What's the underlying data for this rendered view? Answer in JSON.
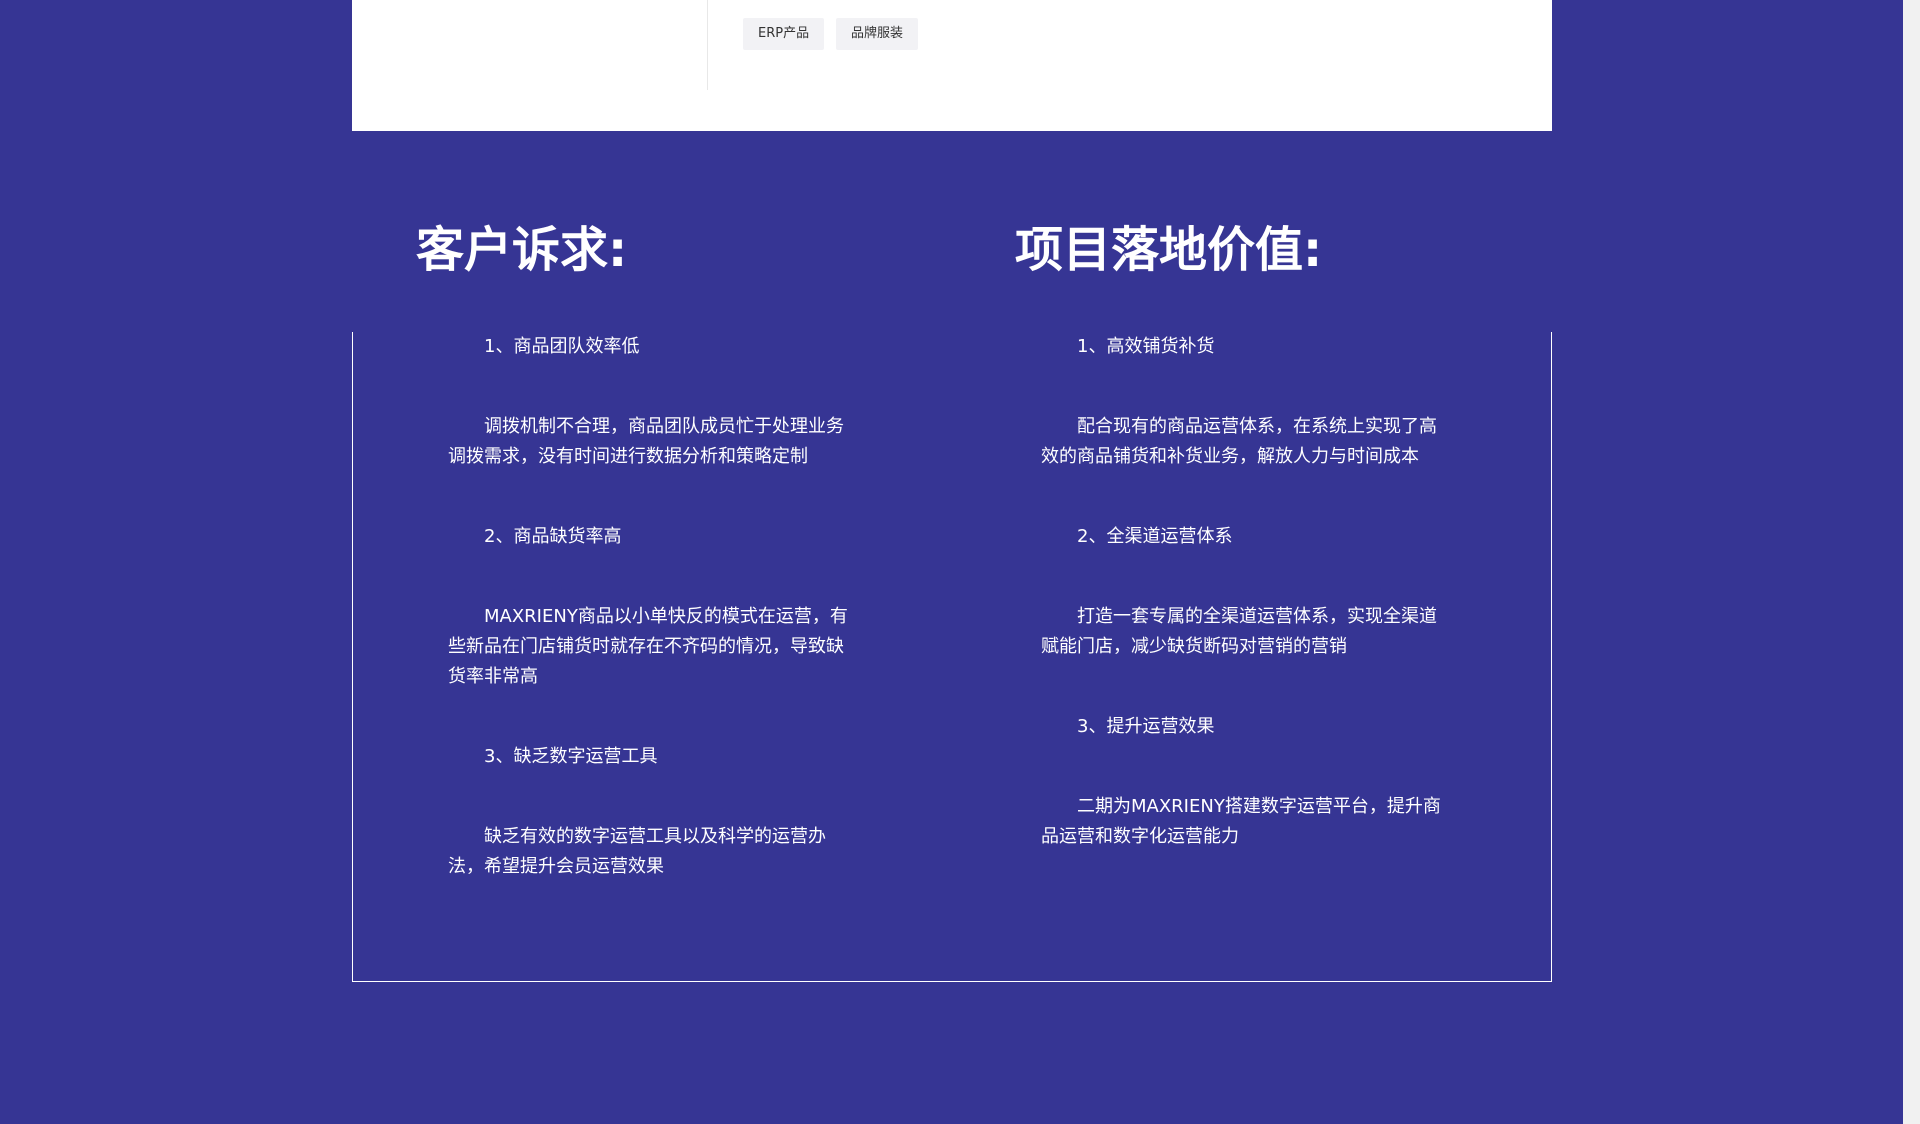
{
  "tags": [
    "ERP产品",
    "品牌服装"
  ],
  "customer_needs": {
    "heading": "客户诉求:",
    "items": [
      {
        "title": "1、商品团队效率低",
        "desc": "调拨机制不合理，商品团队成员忙于处理业务调拨需求，没有时间进行数据分析和策略定制"
      },
      {
        "title": "2、商品缺货率高",
        "desc": "MAXRIENY商品以小单快反的模式在运营，有些新品在门店铺货时就存在不齐码的情况，导致缺货率非常高"
      },
      {
        "title": "3、缺乏数字运营工具",
        "desc": "缺乏有效的数字运营工具以及科学的运营办法，希望提升会员运营效果"
      }
    ]
  },
  "project_value": {
    "heading": "项目落地价值:",
    "items": [
      {
        "title": "1、高效铺货补货",
        "desc": "配合现有的商品运营体系，在系统上实现了高效的商品铺货和补货业务，解放人力与时间成本"
      },
      {
        "title": "2、全渠道运营体系",
        "desc": "打造一套专属的全渠道运营体系，实现全渠道赋能门店，减少缺货断码对营销的营销"
      },
      {
        "title": "3、提升运营效果",
        "desc": "二期为MAXRIENY搭建数字运营平台，提升商品运营和数字化运营能力"
      }
    ]
  }
}
